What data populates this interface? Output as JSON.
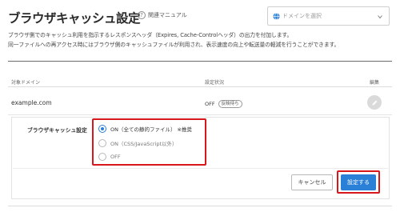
{
  "header": {
    "title": "ブラウザキャッシュ設定",
    "help_label": "関連マニュアル",
    "help_icon": "question-circle-icon"
  },
  "domain_select": {
    "placeholder": "ドメインを選択",
    "icon": "globe-icon"
  },
  "description": {
    "line1": "ブラウザ側でのキャッシュ利用を指示するレスポンスヘッダ（Expires, Cache-Controlヘッダ）の出力を付加します。",
    "line2": "同一ファイルへの再アクセス時にはブラウザ側のキャッシュファイルが利用され、表示速度の向上や転送量の軽減を行うことができます。"
  },
  "table": {
    "headers": {
      "domain": "対象ドメイン",
      "status": "設定状況",
      "edit": "編集"
    },
    "rows": [
      {
        "domain": "example.com",
        "status": "OFF",
        "badge": "反映待ち"
      }
    ]
  },
  "edit_panel": {
    "setting_label": "ブラウザキャッシュ設定",
    "options": [
      {
        "label": "ON（全ての静的ファイル）",
        "note": "※推奨",
        "selected": true
      },
      {
        "label": "ON（CSS/JavaScript以外）",
        "note": "",
        "selected": false
      },
      {
        "label": "OFF",
        "note": "",
        "selected": false
      }
    ],
    "cancel_label": "キャンセル",
    "save_label": "設定する"
  },
  "colors": {
    "accent": "#2a7fd6",
    "highlight": "#d8171d"
  }
}
